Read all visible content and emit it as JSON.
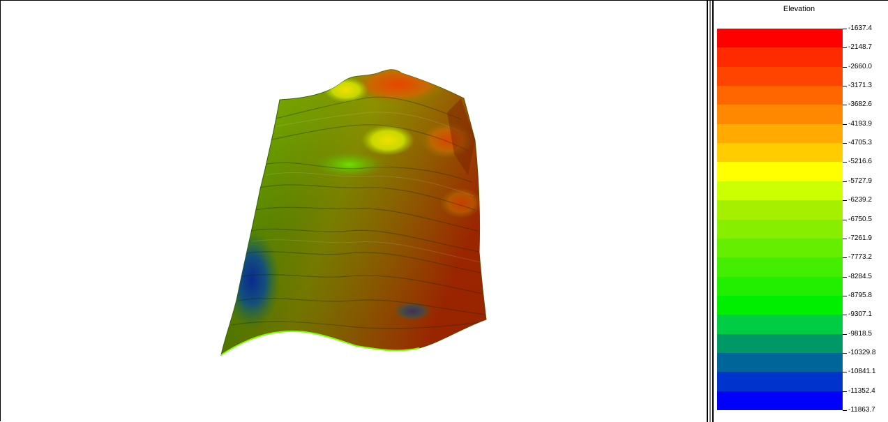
{
  "legend": {
    "title": "Elevation",
    "labels": [
      "-1637.4",
      "-2148.7",
      "-2660.0",
      "-3171.3",
      "-3682.6",
      "-4193.9",
      "-4705.3",
      "-5216.6",
      "-5727.9",
      "-6239.2",
      "-6750.5",
      "-7261.9",
      "-7773.2",
      "-8284.5",
      "-8795.8",
      "-9307.1",
      "-9818.5",
      "-10329.8",
      "-10841.1",
      "-11352.4",
      "-11863.7"
    ],
    "colors": [
      "#ff0000",
      "#ff2a00",
      "#ff4400",
      "#ff6600",
      "#ff8800",
      "#ffaa00",
      "#ffcc00",
      "#ffff00",
      "#ccff00",
      "#a4f000",
      "#88ee00",
      "#66ee00",
      "#44ee00",
      "#22ee00",
      "#00ee00",
      "#00cc44",
      "#009966",
      "#006699",
      "#0033cc",
      "#0000ff"
    ]
  },
  "surface": {
    "colors": {
      "peak": "#cc2200",
      "high": "#d8a000",
      "mid": "#7cc800",
      "low": "#3a8a00",
      "deep": "#0a3a80"
    }
  }
}
